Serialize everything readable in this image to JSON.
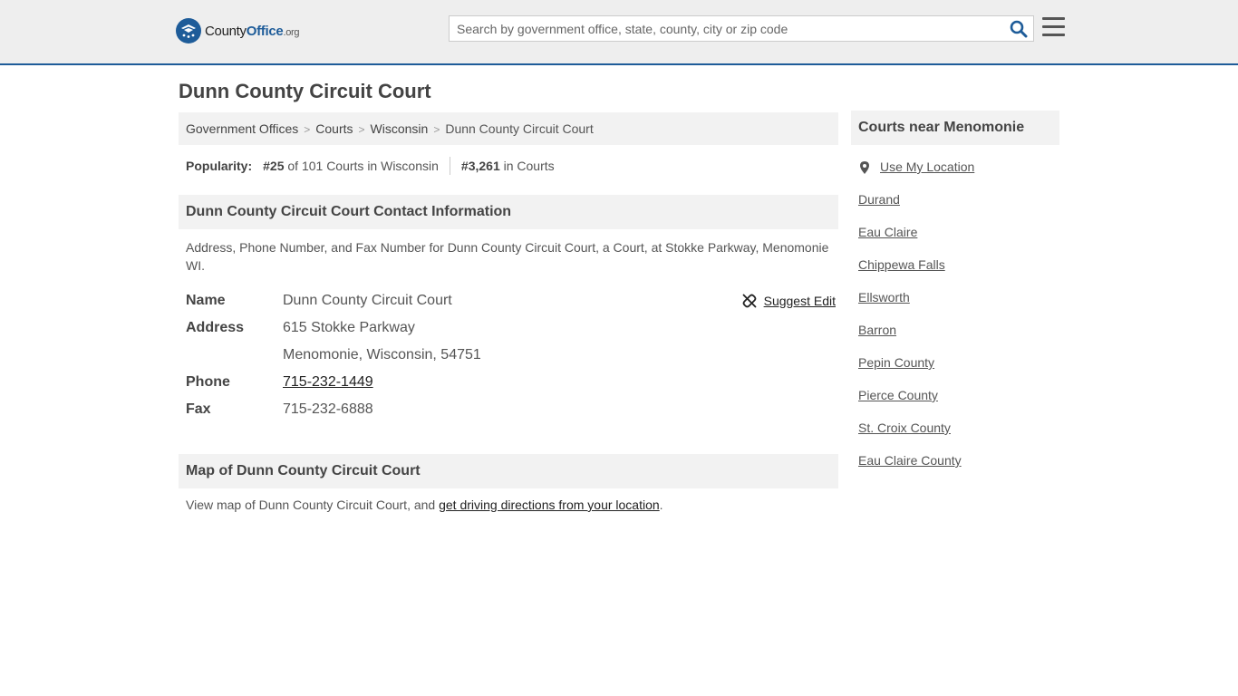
{
  "header": {
    "logo": {
      "text_a": "County",
      "text_b": "Office",
      "text_c": ".org"
    },
    "search": {
      "placeholder": "Search by government office, state, county, city or zip code"
    }
  },
  "page": {
    "title": "Dunn County Circuit Court"
  },
  "breadcrumb": {
    "items": [
      "Government Offices",
      "Courts",
      "Wisconsin",
      "Dunn County Circuit Court"
    ],
    "separator": ">"
  },
  "popularity": {
    "label": "Popularity:",
    "state_rank": "#25",
    "state_text": "of 101 Courts in Wisconsin",
    "national_rank": "#3,261",
    "national_text": "in Courts"
  },
  "contact": {
    "header": "Dunn County Circuit Court Contact Information",
    "description": "Address, Phone Number, and Fax Number for Dunn County Circuit Court, a Court, at Stokke Parkway, Menomonie WI.",
    "suggest_edit": "Suggest Edit",
    "name_label": "Name",
    "name_value": "Dunn County Circuit Court",
    "address_label": "Address",
    "address_line1": "615 Stokke Parkway",
    "address_line2": "Menomonie, Wisconsin, 54751",
    "phone_label": "Phone",
    "phone_value": "715-232-1449",
    "fax_label": "Fax",
    "fax_value": "715-232-6888"
  },
  "map": {
    "header": "Map of Dunn County Circuit Court",
    "desc_prefix": "View map of Dunn County Circuit Court, and ",
    "desc_link": "get driving directions from your location",
    "desc_suffix": "."
  },
  "sidebar": {
    "header": "Courts near Menomonie",
    "use_location": "Use My Location",
    "items": [
      "Durand",
      "Eau Claire",
      "Chippewa Falls",
      "Ellsworth",
      "Barron",
      "Pepin County",
      "Pierce County",
      "St. Croix County",
      "Eau Claire County"
    ]
  },
  "colors": {
    "brand": "#1e5c99",
    "panel": "#f2f2f2",
    "topbar": "#eeeeee"
  }
}
